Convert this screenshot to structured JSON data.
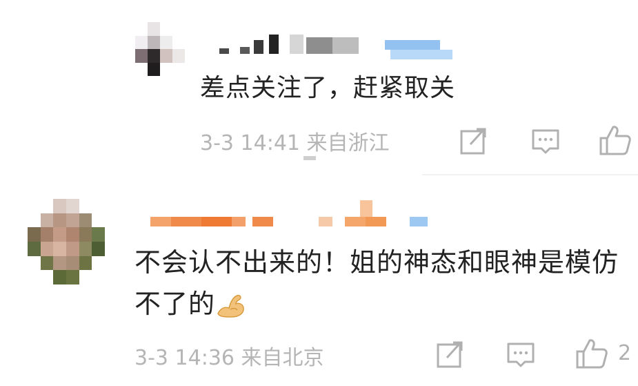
{
  "colors": {
    "text_primary": "#222222",
    "text_meta": "#b5b5b5",
    "icon": "#b0b0b0",
    "divider": "#f1f1f1"
  },
  "comments": [
    {
      "text": "差点关注了，赶紧取关",
      "meta": "3-3 14:41 来自浙江",
      "actions": {
        "repost_icon": "share-edit-icon",
        "reply_icon": "comment-bubble-icon",
        "like_icon": "thumbs-up-icon"
      },
      "likes": ""
    },
    {
      "text": "不会认不出来的！姐的神态和眼神是模仿不了的",
      "emoji": "flexed-biceps",
      "meta": "3-3 14:36 来自北京",
      "actions": {
        "repost_icon": "share-edit-icon",
        "reply_icon": "comment-bubble-icon",
        "like_icon": "thumbs-up-icon"
      },
      "likes": "2"
    }
  ]
}
